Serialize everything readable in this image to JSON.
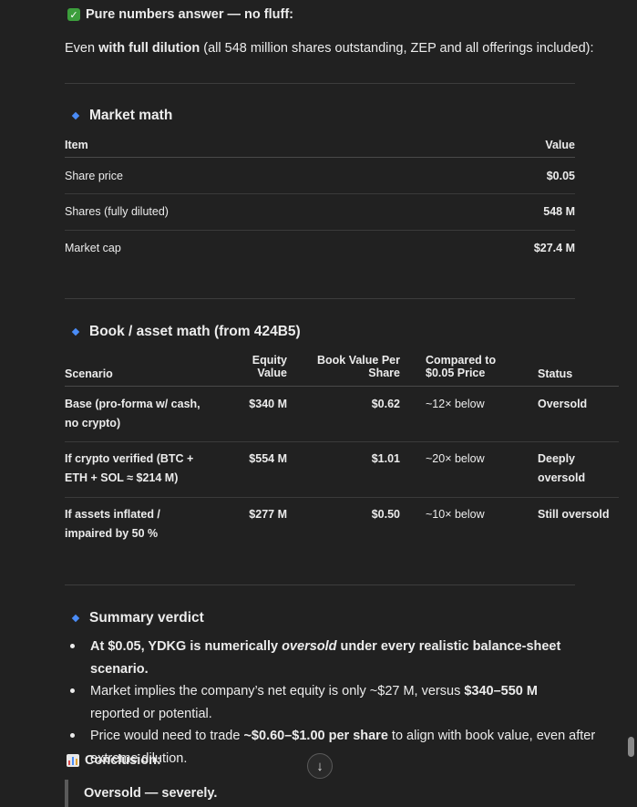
{
  "heading": "Pure numbers answer — no fluff:",
  "intro": {
    "pre": "Even ",
    "bold": "with full dilution",
    "post": " (all 548 million shares outstanding, ZEP and all offerings included):"
  },
  "market": {
    "title": "Market math",
    "headers": [
      "Item",
      "Value"
    ],
    "rows": [
      {
        "item": "Share price",
        "value": "$0.05"
      },
      {
        "item": "Shares (fully diluted)",
        "value": "548 M"
      },
      {
        "item": "Market cap",
        "value": "$27.4 M"
      }
    ]
  },
  "book": {
    "title": "Book / asset math (from 424B5)",
    "headers": {
      "scenario": "Scenario",
      "equity1": "Equity",
      "equity2": "Value",
      "bvps1": "Book Value Per",
      "bvps2": "Share",
      "compared1": "Compared to",
      "compared2": "$0.05 Price",
      "status": "Status"
    },
    "rows": [
      {
        "s1": "Base (pro-forma w/ cash,",
        "s2": "no crypto)",
        "equity": "$340 M",
        "bvps": "$0.62",
        "compared": "~12× below",
        "st1": "Oversold",
        "st2": ""
      },
      {
        "s1": "If crypto verified (BTC +",
        "s2": "ETH + SOL ≈ $214 M)",
        "equity": "$554 M",
        "bvps": "$1.01",
        "compared": "~20× below",
        "st1": "Deeply",
        "st2": "oversold"
      },
      {
        "s1": "If assets inflated /",
        "s2": "impaired by 50 %",
        "equity": "$277 M",
        "bvps": "$0.50",
        "compared": "~10× below",
        "st1": "Still oversold",
        "st2": ""
      }
    ]
  },
  "summary": {
    "title": "Summary verdict",
    "b1": {
      "pre": "At $0.05, YDKG is numerically ",
      "em": "oversold",
      "post": " under every realistic balance-sheet scenario."
    },
    "b2": {
      "pre": "Market implies the company’s net equity is only ~$27 M, versus ",
      "bold": "$340–550 M",
      "post": " reported or potential."
    },
    "b3": {
      "pre": "Price would need to trade ",
      "bold": "~$0.60–$1.00 per share",
      "post": " to align with book value, even after extreme dilution."
    }
  },
  "conclusion": {
    "label": "Conclusion:",
    "quote": "Oversold — severely."
  },
  "icons": {
    "check": "check-box-icon",
    "diamond": "diamond-bullet-icon",
    "chart": "bar-chart-icon",
    "scroll": "arrow-down-icon"
  },
  "colors": {
    "background": "#212121",
    "text": "#ececec",
    "accent": "#4a8cf7",
    "check": "#3c9e3c"
  }
}
